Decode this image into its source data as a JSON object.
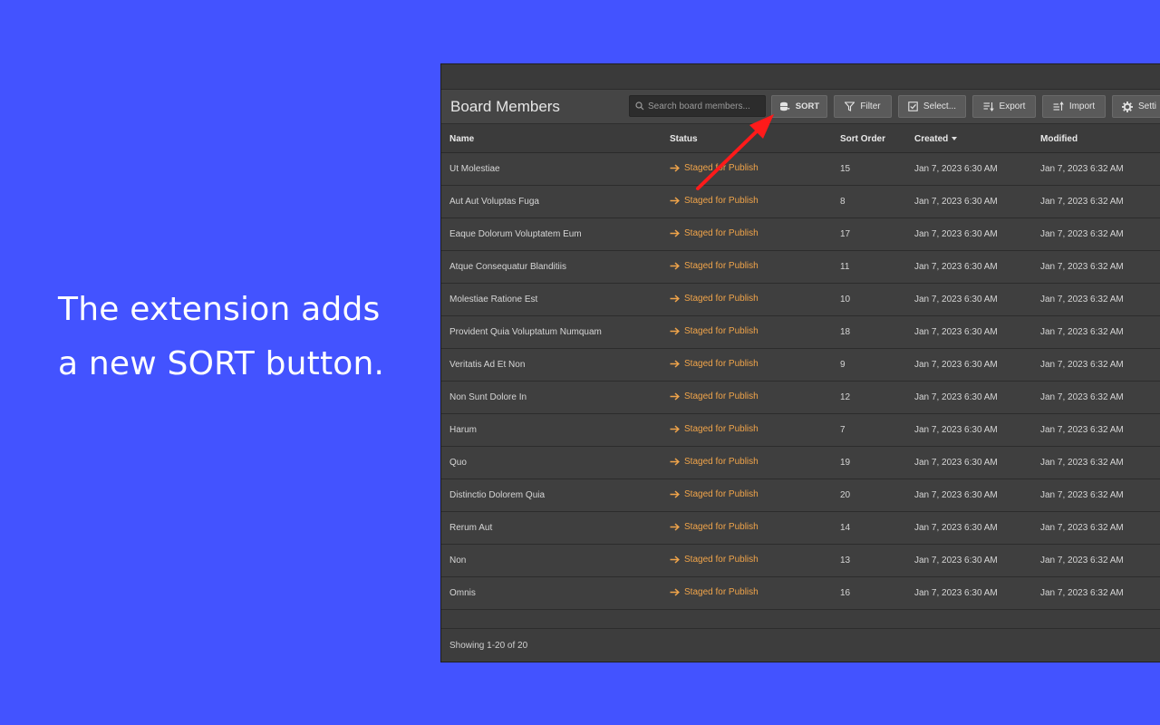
{
  "promo": {
    "line1": "The extension adds",
    "line2": "a new SORT button."
  },
  "header": {
    "title": "Board Members",
    "search_placeholder": "Search board members..."
  },
  "toolbar": {
    "sort_label": "SORT",
    "filter_label": "Filter",
    "select_label": "Select...",
    "export_label": "Export",
    "import_label": "Import",
    "settings_label": "Setti"
  },
  "columns": {
    "name": "Name",
    "status": "Status",
    "sort_order": "Sort Order",
    "created": "Created",
    "modified": "Modified"
  },
  "rows": [
    {
      "name": "Ut Molestiae",
      "status": "Staged for Publish",
      "sort_order": "15",
      "created": "Jan 7, 2023 6:30 AM",
      "modified": "Jan 7, 2023 6:32 AM"
    },
    {
      "name": "Aut Aut Voluptas Fuga",
      "status": "Staged for Publish",
      "sort_order": "8",
      "created": "Jan 7, 2023 6:30 AM",
      "modified": "Jan 7, 2023 6:32 AM"
    },
    {
      "name": "Eaque Dolorum Voluptatem Eum",
      "status": "Staged for Publish",
      "sort_order": "17",
      "created": "Jan 7, 2023 6:30 AM",
      "modified": "Jan 7, 2023 6:32 AM"
    },
    {
      "name": "Atque Consequatur Blanditiis",
      "status": "Staged for Publish",
      "sort_order": "11",
      "created": "Jan 7, 2023 6:30 AM",
      "modified": "Jan 7, 2023 6:32 AM"
    },
    {
      "name": "Molestiae Ratione Est",
      "status": "Staged for Publish",
      "sort_order": "10",
      "created": "Jan 7, 2023 6:30 AM",
      "modified": "Jan 7, 2023 6:32 AM"
    },
    {
      "name": "Provident Quia Voluptatum Numquam",
      "status": "Staged for Publish",
      "sort_order": "18",
      "created": "Jan 7, 2023 6:30 AM",
      "modified": "Jan 7, 2023 6:32 AM"
    },
    {
      "name": "Veritatis Ad Et Non",
      "status": "Staged for Publish",
      "sort_order": "9",
      "created": "Jan 7, 2023 6:30 AM",
      "modified": "Jan 7, 2023 6:32 AM"
    },
    {
      "name": "Non Sunt Dolore In",
      "status": "Staged for Publish",
      "sort_order": "12",
      "created": "Jan 7, 2023 6:30 AM",
      "modified": "Jan 7, 2023 6:32 AM"
    },
    {
      "name": "Harum",
      "status": "Staged for Publish",
      "sort_order": "7",
      "created": "Jan 7, 2023 6:30 AM",
      "modified": "Jan 7, 2023 6:32 AM"
    },
    {
      "name": "Quo",
      "status": "Staged for Publish",
      "sort_order": "19",
      "created": "Jan 7, 2023 6:30 AM",
      "modified": "Jan 7, 2023 6:32 AM"
    },
    {
      "name": "Distinctio Dolorem Quia",
      "status": "Staged for Publish",
      "sort_order": "20",
      "created": "Jan 7, 2023 6:30 AM",
      "modified": "Jan 7, 2023 6:32 AM"
    },
    {
      "name": "Rerum Aut",
      "status": "Staged for Publish",
      "sort_order": "14",
      "created": "Jan 7, 2023 6:30 AM",
      "modified": "Jan 7, 2023 6:32 AM"
    },
    {
      "name": "Non",
      "status": "Staged for Publish",
      "sort_order": "13",
      "created": "Jan 7, 2023 6:30 AM",
      "modified": "Jan 7, 2023 6:32 AM"
    },
    {
      "name": "Omnis",
      "status": "Staged for Publish",
      "sort_order": "16",
      "created": "Jan 7, 2023 6:30 AM",
      "modified": "Jan 7, 2023 6:32 AM"
    }
  ],
  "footer": {
    "showing": "Showing 1-20 of 20"
  },
  "colors": {
    "background": "#4353ff",
    "status": "#f0a44a",
    "arrow": "#ff1a1a"
  }
}
